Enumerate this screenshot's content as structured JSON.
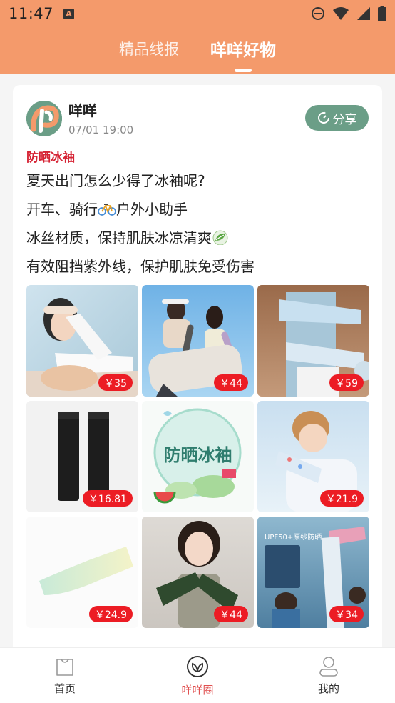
{
  "status_bar": {
    "time": "11:47",
    "app_icon_letter": "A"
  },
  "header": {
    "tabs": [
      {
        "label": "精品线报",
        "active": false
      },
      {
        "label": "咩咩好物",
        "active": true
      }
    ]
  },
  "post": {
    "author": "咩咩",
    "time": "07/01 19:00",
    "share_label": "分享",
    "tag": "防晒冰袖",
    "lines": [
      {
        "text": "夏天出门怎么少得了冰袖呢?",
        "icon": ""
      },
      {
        "text": "开车、骑行",
        "icon": "bicycle-icon",
        "text_after": "户外小助手"
      },
      {
        "text": "冰丝材质，保持肌肤冰凉清爽",
        "icon": "leaf-icon",
        "text_after": ""
      },
      {
        "text": "有效阻挡紫外线，保护肌肤免受伤害",
        "icon": ""
      }
    ],
    "products": [
      {
        "price": "￥35",
        "kind": "woman-visor"
      },
      {
        "price": "￥44",
        "kind": "couple-surfboard"
      },
      {
        "price": "￥59",
        "kind": "arms-white"
      },
      {
        "price": "￥16.81",
        "kind": "black-sleeves"
      },
      {
        "price": "",
        "kind": "promo-badge",
        "badge_text": "防晒冰袖"
      },
      {
        "price": "￥21.9",
        "kind": "child-sleeve"
      },
      {
        "price": "￥24.9",
        "kind": "gradient-sleeve"
      },
      {
        "price": "￥44",
        "kind": "woman-green-sleeves"
      },
      {
        "price": "￥34",
        "kind": "family-upf"
      }
    ],
    "upf_text": "UPF50+原纱防晒"
  },
  "bottom_nav": {
    "items": [
      {
        "label": "首页",
        "icon": "home-bag-icon",
        "active": false
      },
      {
        "label": "咩咩圈",
        "icon": "circle-leaf-icon",
        "active": true
      },
      {
        "label": "我的",
        "icon": "profile-icon",
        "active": false
      }
    ]
  },
  "colors": {
    "header": "#f49a6b",
    "accent_green": "#6b9e87",
    "tag_red": "#d62435",
    "price_red": "#ec1c24",
    "nav_active": "#e05050"
  }
}
